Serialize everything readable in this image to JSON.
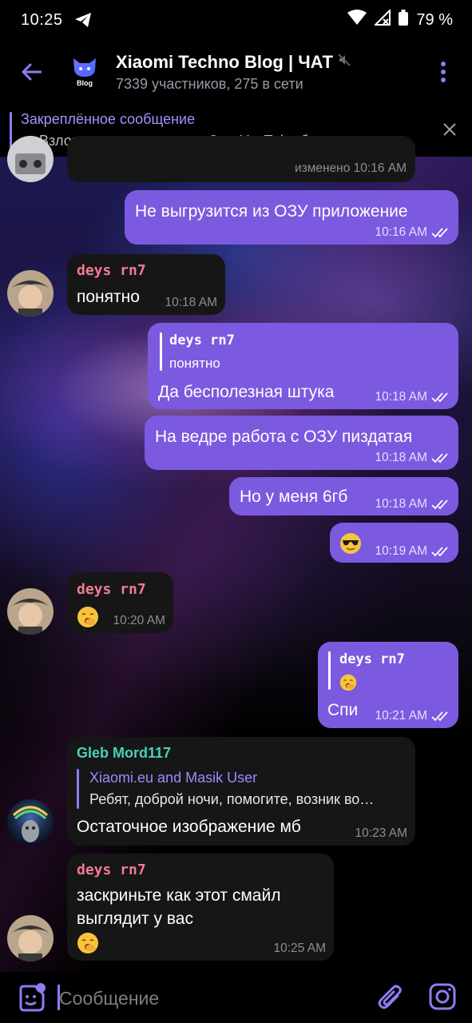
{
  "status_bar": {
    "time": "10:25",
    "battery": "79 %"
  },
  "header": {
    "avatar_text": "Blog",
    "title": "Xiaomi Techno Blog | ЧАТ",
    "subtitle": "7339 участников, 275 в сети"
  },
  "pinned": {
    "title": "Закреплённое сообщение",
    "text": "— Взломанные приложения?  — YouTube без реклам…"
  },
  "messages": [
    {
      "id": "m0",
      "dir": "in",
      "time": "изменено 10:16 AM"
    },
    {
      "id": "m1",
      "dir": "out",
      "text": "Не выгрузится из ОЗУ приложение",
      "time": "10:16 AM"
    },
    {
      "id": "m2",
      "dir": "in",
      "sender": "deys rn7",
      "text": "понятно",
      "time": "10:18 AM"
    },
    {
      "id": "m3",
      "dir": "out",
      "reply_name": "deys rn7",
      "reply_text": "понятно",
      "text": "Да бесполезная штука",
      "time": "10:18 AM"
    },
    {
      "id": "m4",
      "dir": "out",
      "text": "На ведре работа с ОЗУ пиздатая",
      "time": "10:18 AM"
    },
    {
      "id": "m5",
      "dir": "out",
      "text": "Но у меня 6гб",
      "time": "10:18 AM"
    },
    {
      "id": "m6",
      "dir": "out",
      "emoji": "sunglasses-emoji",
      "time": "10:19 AM"
    },
    {
      "id": "m7",
      "dir": "in",
      "sender": "deys rn7",
      "emoji": "yawning-emoji",
      "time": "10:20 AM"
    },
    {
      "id": "m8",
      "dir": "out",
      "reply_name": "deys rn7",
      "reply_emoji": "yawning-emoji",
      "text": "Спи",
      "time": "10:21 AM"
    },
    {
      "id": "m9",
      "dir": "in",
      "sender": "Gleb Mord117",
      "reply_name": "Xiaomi.eu and Masik User",
      "reply_text": "Ребят, доброй ночи, помогите, возник во…",
      "text": "Остаточное изображение мб",
      "time": "10:23 AM"
    },
    {
      "id": "m10",
      "dir": "in",
      "sender": "deys rn7",
      "text_line1": "заскриньте как этот смайл",
      "text_line2": "выглядит у вас",
      "emoji": "yawning-emoji",
      "time": "10:25 AM"
    }
  ],
  "input": {
    "placeholder": "Сообщение"
  },
  "colors": {
    "outgoing_bubble": "#7b5ae0",
    "incoming_bubble": "#161616",
    "accent": "#8e7cf0",
    "sender_pink": "#f47a96",
    "sender_teal": "#4bd0b8"
  },
  "icons": [
    "telegram-send-icon",
    "wifi-icon",
    "no-signal-icon",
    "battery-icon",
    "back-arrow-icon",
    "mute-icon",
    "more-vert-icon",
    "close-icon",
    "double-check-icon",
    "sticker-icon",
    "attach-icon",
    "camera-icon"
  ]
}
